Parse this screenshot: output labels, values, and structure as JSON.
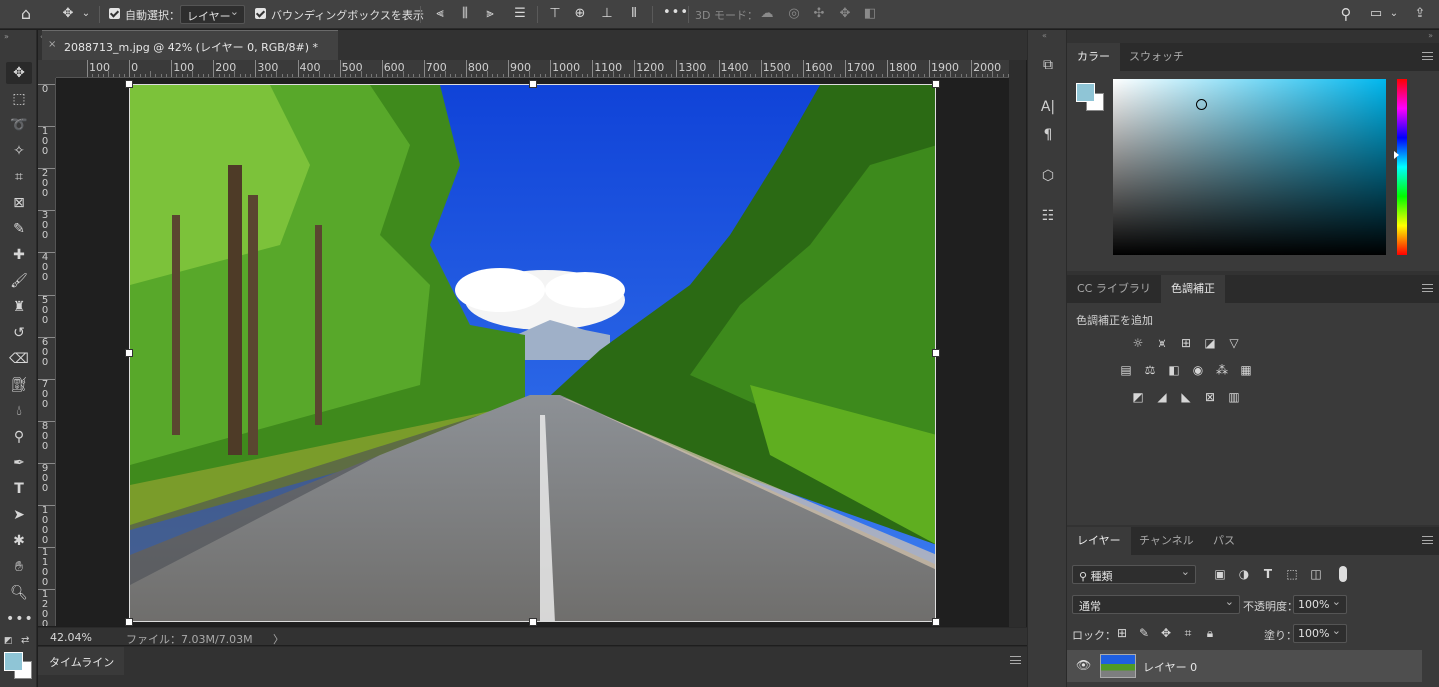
{
  "options_bar": {
    "auto_select_label": "自動選択：",
    "auto_select_value": "レイヤー",
    "bounding_box_label": "バウンディングボックスを表示",
    "more_label": "•••",
    "mode3d_label": "3D モード："
  },
  "document": {
    "tab_title": "2088713_m.jpg @ 42% (レイヤー 0, RGB/8#) *",
    "close_glyph": "×",
    "zoom": "42.04%",
    "file_info": "ファイル：7.03M/7.03M",
    "status_arrow": "〉"
  },
  "ruler": {
    "h_labels": [
      "100",
      "0",
      "100",
      "200",
      "300",
      "400",
      "500",
      "600",
      "700",
      "800",
      "900",
      "1000",
      "1100",
      "1200",
      "1300",
      "1400",
      "1500",
      "1600",
      "1700",
      "1800",
      "1900",
      "2000"
    ],
    "v_labels": [
      "0",
      "1\n0\n0",
      "2\n0\n0",
      "3\n0\n0",
      "4\n0\n0",
      "5\n0\n0",
      "6\n0\n0",
      "7\n0\n0",
      "8\n0\n0",
      "9\n0\n0",
      "1\n0\n0\n0",
      "1\n1\n0\n0",
      "1\n2\n0\n0"
    ]
  },
  "timeline": {
    "label": "タイムライン"
  },
  "color_panel": {
    "tabs": [
      "カラー",
      "スウォッチ"
    ],
    "foreground_color": "#8fc5d6",
    "hue_color": "#00b7ee"
  },
  "adjustments_panel": {
    "tabs": [
      "CC ライブラリ",
      "色調補正"
    ],
    "add_label": "色調補正を追加"
  },
  "layers_panel": {
    "tabs": [
      "レイヤー",
      "チャンネル",
      "パス"
    ],
    "filter_label": "種類",
    "blend_mode": "通常",
    "opacity_label": "不透明度：",
    "opacity_value": "100%",
    "lock_label": "ロック：",
    "fill_label": "塗り：",
    "fill_value": "100%",
    "layers": [
      {
        "name": "レイヤー 0",
        "visible": true
      }
    ]
  },
  "colors": {
    "accent_ui": "#424242",
    "panel_bg": "#323232"
  }
}
